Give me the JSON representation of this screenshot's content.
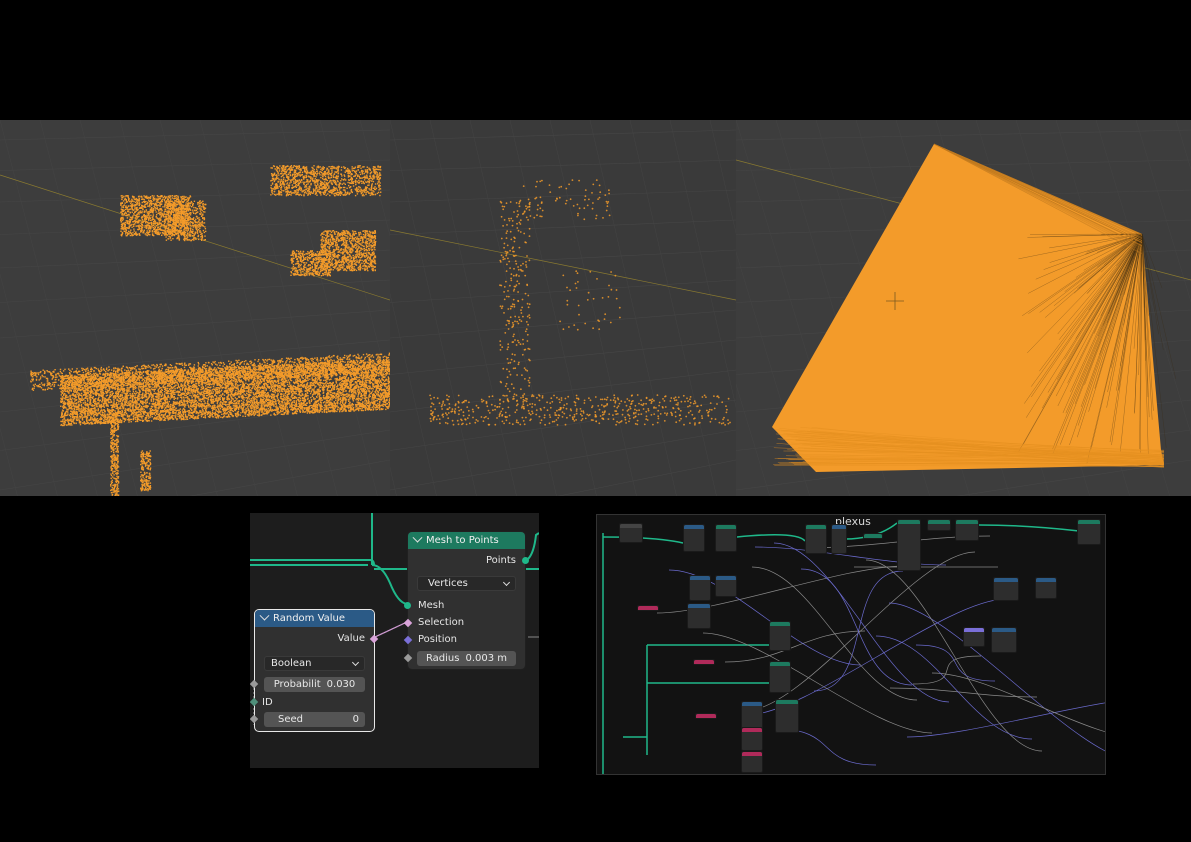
{
  "viewports": [
    {
      "name": "dense-point-cloud"
    },
    {
      "name": "sparse-point-cloud"
    },
    {
      "name": "plexus-mesh"
    }
  ],
  "colors": {
    "accent_orange": "#f39b2a",
    "viewport_bg": "#3d3d3d",
    "geo_header": "#1d7a5f",
    "func_header": "#2b5a86",
    "link_green": "#1fb88a",
    "socket_purple": "#7a6fd8",
    "socket_pink": "#d9a3d9"
  },
  "mesh_to_points": {
    "title": "Mesh to Points",
    "output": "Points",
    "mode": "Vertices",
    "inputs": [
      "Mesh",
      "Selection",
      "Position"
    ],
    "radius_label": "Radius",
    "radius_value": "0.003 m"
  },
  "random_value": {
    "title": "Random Value",
    "output": "Value",
    "type": "Boolean",
    "probability_label": "Probabilit",
    "probability_value": "0.030",
    "id_label": "ID",
    "seed_label": "Seed",
    "seed_value": "0"
  },
  "plexus_panel": {
    "title": "plexus"
  }
}
